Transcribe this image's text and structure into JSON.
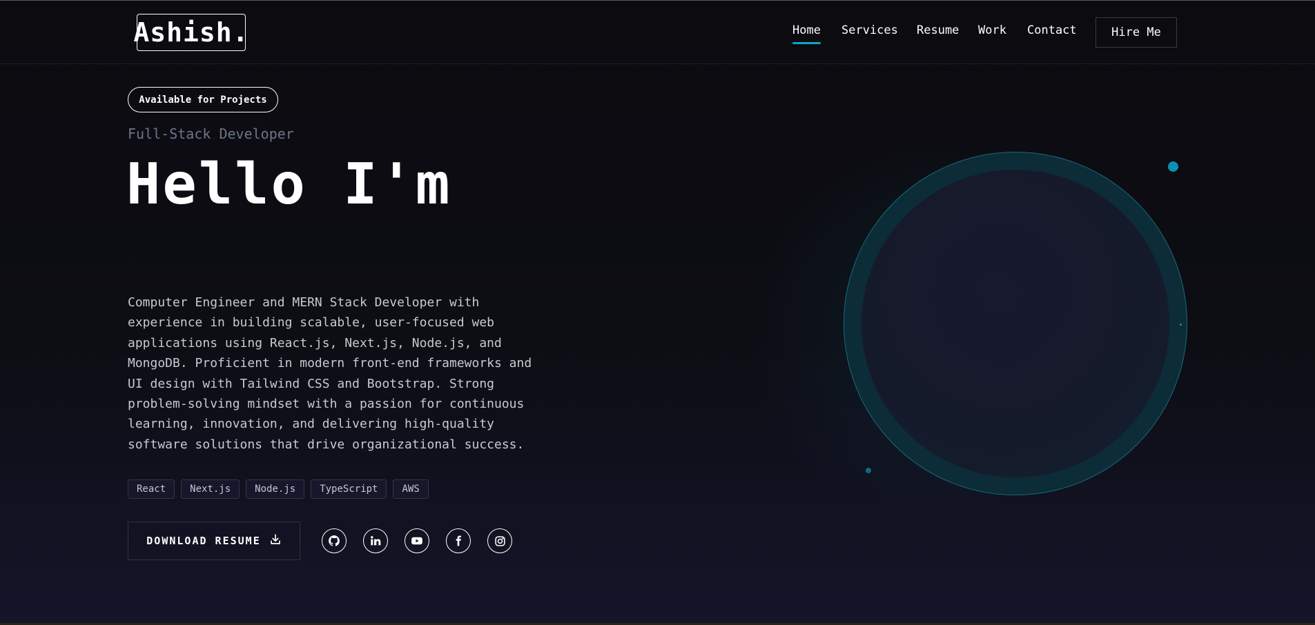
{
  "header": {
    "logo": "Ashish.",
    "nav": [
      {
        "label": "Home",
        "active": true
      },
      {
        "label": "Services",
        "active": false
      },
      {
        "label": "Resume",
        "active": false
      },
      {
        "label": "Work",
        "active": false
      },
      {
        "label": "Contact",
        "active": false
      }
    ],
    "hire_label": "Hire Me"
  },
  "hero": {
    "badge": "Available for Projects",
    "subtitle": "Full-Stack Developer",
    "headline": "Hello I'm",
    "description": "Computer Engineer and MERN Stack Developer with experience in building scalable, user-focused web applications using React.js, Next.js, Node.js, and MongoDB. Proficient in modern front-end frameworks and UI design with Tailwind CSS and Bootstrap. Strong problem-solving mindset with a passion for continuous learning, innovation, and delivering high-quality software solutions that drive organizational success.",
    "tags": [
      "React",
      "Next.js",
      "Node.js",
      "TypeScript",
      "AWS"
    ],
    "download_label": "DOWNLOAD RESUME",
    "download_icon": "download-icon",
    "socials": [
      "github-icon",
      "linkedin-icon",
      "youtube-icon",
      "facebook-icon",
      "instagram-icon"
    ]
  },
  "colors": {
    "accent": "#0ea5c7",
    "background": "#0b0b10",
    "ring": "#0b2a35"
  }
}
